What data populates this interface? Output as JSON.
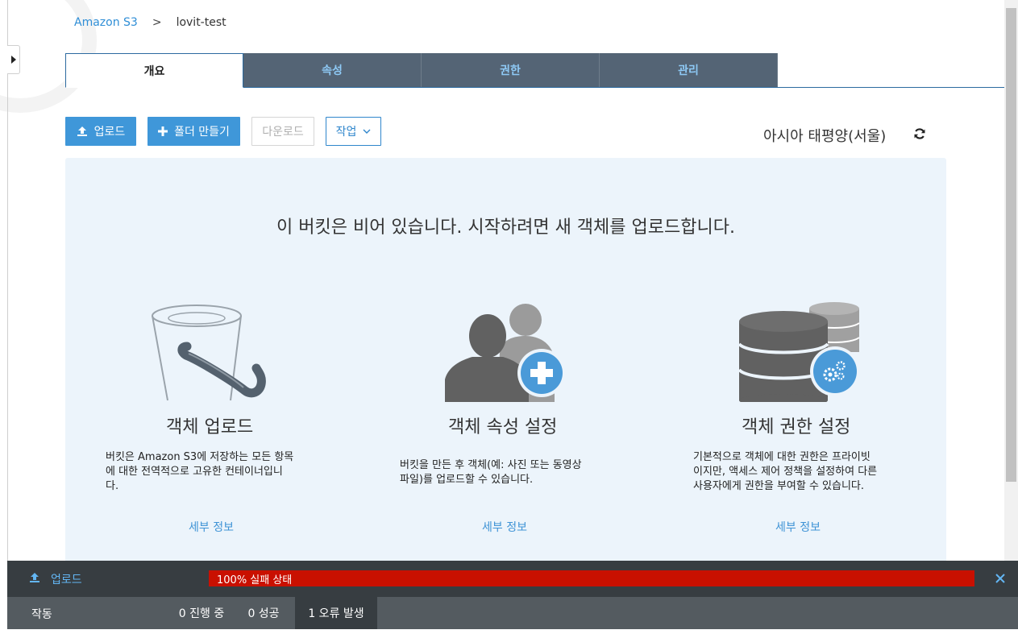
{
  "breadcrumb": {
    "root": "Amazon S3",
    "separator": ">",
    "current": "lovit-test"
  },
  "tabs": [
    {
      "label": "개요",
      "active": true
    },
    {
      "label": "속성",
      "active": false
    },
    {
      "label": "권한",
      "active": false
    },
    {
      "label": "관리",
      "active": false
    }
  ],
  "toolbar": {
    "upload": "업로드",
    "create_folder": "폴더 만들기",
    "download": "다운로드",
    "actions": "작업"
  },
  "region": "아시아 태평양(서울)",
  "empty_state": {
    "headline": "이 버킷은 비어 있습니다. 시작하려면 새 객체를 업로드합니다.",
    "cards": [
      {
        "icon": "bucket-icon",
        "title": "객체 업로드",
        "lines": [
          "버킷은 Amazon S3에 저장하는 모든 항목",
          "에 대한 전역적으로 고유한 컨테이너입니",
          "다."
        ],
        "link": "세부 정보"
      },
      {
        "icon": "user-add-icon",
        "title": "객체 속성 설정",
        "lines": [
          "버킷을 만든 후 객체(예: 사진 또는 동영상",
          "파일)를 업로드할 수 있습니다."
        ],
        "link": "세부 정보"
      },
      {
        "icon": "database-settings-icon",
        "title": "객체 권한 설정",
        "lines": [
          "기본적으로 객체에 대한 권한은 프라이빗",
          "이지만, 액세스 제어 정책을 설정하여 다른",
          "사용자에게 권한을 부여할 수 있습니다."
        ],
        "link": "세부 정보"
      }
    ]
  },
  "upload_bar": {
    "label": "업로드",
    "progress_text": "100% 실패 상태",
    "progress_percent": 100
  },
  "status_bar": {
    "label": "작동",
    "in_progress": "0 진행 중",
    "success": "0 성공",
    "errors": "1 오류 발생"
  },
  "colors": {
    "accent": "#3f97d9",
    "tab_inactive": "#546475",
    "panel": "#ecf4fb",
    "error": "#c91000",
    "upload_bar": "#373d41"
  }
}
